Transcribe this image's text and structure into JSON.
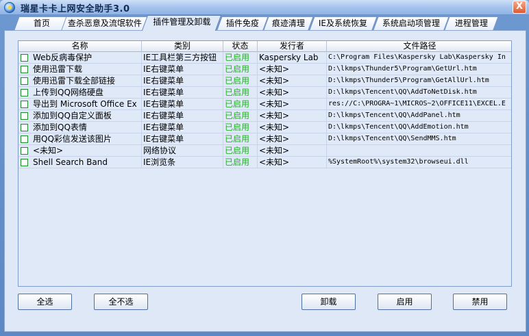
{
  "window": {
    "title": "瑞星卡卡上网安全助手3.0",
    "close_glyph": "X"
  },
  "tabs": [
    {
      "label": "首页"
    },
    {
      "label": "查杀恶意及流氓软件"
    },
    {
      "label": "插件管理及卸载"
    },
    {
      "label": "插件免疫"
    },
    {
      "label": "痕迹清理"
    },
    {
      "label": "IE及系统恢复"
    },
    {
      "label": "系统启动项管理"
    },
    {
      "label": "进程管理"
    }
  ],
  "table": {
    "columns": [
      "名称",
      "类别",
      "状态",
      "发行者",
      "文件路径"
    ],
    "rows": [
      {
        "name": "Web反病毒保护",
        "category": "IE工具栏第三方按钮",
        "status": "已启用",
        "publisher": "Kaspersky Lab",
        "path": "C:\\Program Files\\Kaspersky Lab\\Kaspersky In"
      },
      {
        "name": "使用迅雷下载",
        "category": "IE右键菜单",
        "status": "已启用",
        "publisher": "<未知>",
        "path": "D:\\lkmps\\Thunder5\\Program\\GetUrl.htm"
      },
      {
        "name": "使用迅雷下载全部链接",
        "category": "IE右键菜单",
        "status": "已启用",
        "publisher": "<未知>",
        "path": "D:\\lkmps\\Thunder5\\Program\\GetAllUrl.htm"
      },
      {
        "name": "上传到QQ网络硬盘",
        "category": "IE右键菜单",
        "status": "已启用",
        "publisher": "<未知>",
        "path": "D:\\lkmps\\Tencent\\QQ\\AddToNetDisk.htm"
      },
      {
        "name": "导出到 Microsoft Office Ex",
        "category": "IE右键菜单",
        "status": "已启用",
        "publisher": "<未知>",
        "path": "res://C:\\PROGRA~1\\MICROS~2\\OFFICE11\\EXCEL.E"
      },
      {
        "name": "添加到QQ自定义面板",
        "category": "IE右键菜单",
        "status": "已启用",
        "publisher": "<未知>",
        "path": "D:\\lkmps\\Tencent\\QQ\\AddPanel.htm"
      },
      {
        "name": "添加到QQ表情",
        "category": "IE右键菜单",
        "status": "已启用",
        "publisher": "<未知>",
        "path": "D:\\lkmps\\Tencent\\QQ\\AddEmotion.htm"
      },
      {
        "name": "用QQ彩信发送该图片",
        "category": "IE右键菜单",
        "status": "已启用",
        "publisher": "<未知>",
        "path": "D:\\lkmps\\Tencent\\QQ\\SendMMS.htm"
      },
      {
        "name": "<未知>",
        "category": "网络协议",
        "status": "已启用",
        "publisher": "<未知>",
        "path": ""
      },
      {
        "name": "Shell Search Band",
        "category": "IE浏览条",
        "status": "已启用",
        "publisher": "<未知>",
        "path": "%SystemRoot%\\system32\\browseui.dll"
      }
    ]
  },
  "buttons": {
    "select_all": "全选",
    "deselect_all": "全不选",
    "uninstall": "卸载",
    "enable": "启用",
    "disable": "禁用"
  },
  "colors": {
    "status_enabled": "#22b122",
    "window_frame": "#6d98d0",
    "panel_bg": "#dee8f7"
  }
}
